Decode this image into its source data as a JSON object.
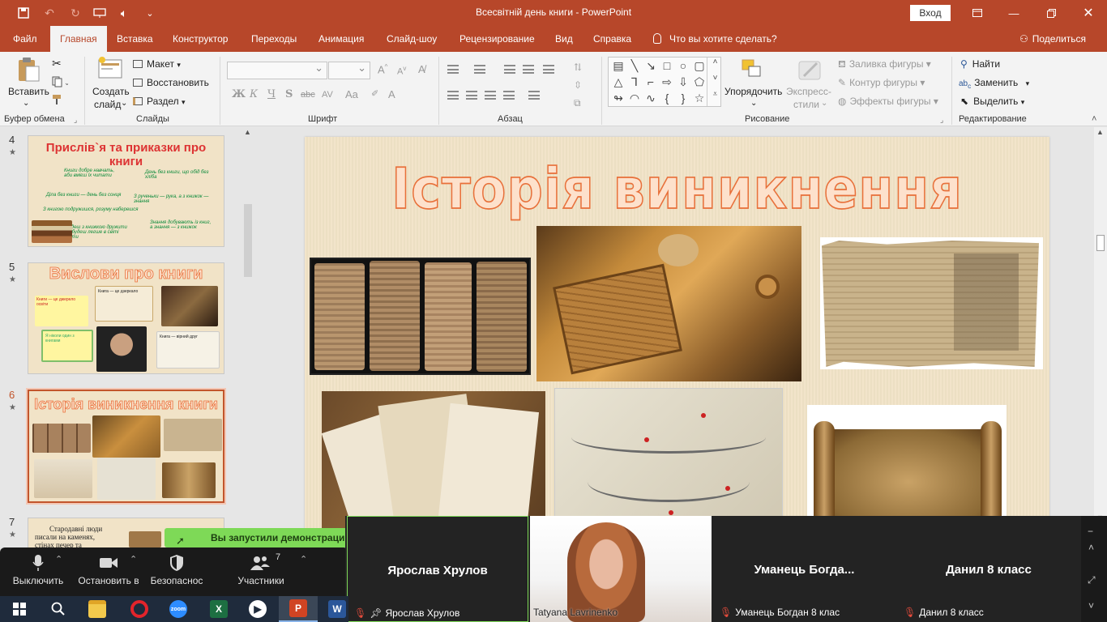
{
  "titlebar": {
    "document_title": "Всесвітній день книги  -  PowerPoint",
    "signin_label": "Вход",
    "icons": [
      "save-icon",
      "undo-icon",
      "redo-icon",
      "start-from-beginning-icon",
      "audio-icon",
      "customize-quick-access-icon",
      "ribbon-display-options-icon",
      "minimize-icon",
      "restore-icon",
      "close-icon"
    ]
  },
  "tabs": [
    "Файл",
    "Главная",
    "Вставка",
    "Конструктор",
    "Переходы",
    "Анимация",
    "Слайд-шоу",
    "Рецензирование",
    "Вид",
    "Справка"
  ],
  "active_tab": "Главная",
  "tell_me": "Что вы хотите сделать?",
  "share": "Поделиться",
  "ribbon": {
    "clipboard": {
      "paste": "Вставить",
      "group": "Буфер обмена"
    },
    "slides": {
      "new_slide_line1": "Создать",
      "new_slide_line2": "слайд",
      "layout": "Макет",
      "reset": "Восстановить",
      "section": "Раздел",
      "group": "Слайды"
    },
    "font": {
      "group": "Шрифт",
      "bold": "Ж",
      "italic": "К",
      "underline": "Ч",
      "shadow": "S",
      "strike": "abc",
      "spacing": "AV",
      "case": "Aa",
      "font_color": "A"
    },
    "paragraph": {
      "group": "Абзац"
    },
    "drawing": {
      "arrange": "Упорядочить",
      "quick_styles_line1": "Экспресс-",
      "quick_styles_line2": "стили",
      "fill": "Заливка фигуры",
      "outline": "Контур фигуры",
      "effects": "Эффекты фигуры",
      "group": "Рисование"
    },
    "editing": {
      "find": "Найти",
      "replace": "Заменить",
      "select": "Выделить",
      "group": "Редактирование"
    }
  },
  "slides_panel": [
    {
      "number": "4",
      "title": "Прислів`я та приказки про книги",
      "texts": [
        "Книги добре навчать, аби вмієш їх читати",
        "День без книги, що обід без хліба",
        "Діла без книги — день без сонця",
        "З рученьки — рука, а з книжок — знання",
        "З книгою подружишся, розуму наберешся",
        "Будеш з книжкою дружити — будеш легше в світі жити",
        "Знання добувають із книг, а знання — з книжок"
      ]
    },
    {
      "number": "5",
      "title": "Вислови про книги",
      "texts": [
        "Книги — це джерело освіти",
        "Книга — це дзеркало",
        "Я ніколи один з книгами",
        "Книга — вірний друг"
      ]
    },
    {
      "number": "6",
      "title": "Історія виникнення книги",
      "selected": true
    },
    {
      "number": "7",
      "texts": [
        "Стародавні люди",
        "писали на каменях,",
        "стінах печер та"
      ]
    }
  ],
  "slide": {
    "title": "Історія виникнення книги"
  },
  "notification": "Вы запустили демонстрацию",
  "zoom_controls": [
    {
      "label": "Выключить",
      "icon": "microphone-icon"
    },
    {
      "label": "Остановить в",
      "icon": "video-camera-icon"
    },
    {
      "label": "Безопаснос",
      "icon": "shield-icon"
    },
    {
      "label": "Участники",
      "icon": "participants-icon",
      "count": "7"
    }
  ],
  "video_tiles": [
    {
      "name": "Ярослав Хрулов",
      "label": "Ярослав Хрулов"
    },
    {
      "name": "",
      "label": "Tatyana Lavrinenko"
    },
    {
      "name": "Уманець  Богда...",
      "label": "Уманець Богдан 8 клас"
    },
    {
      "name": "Данил 8 класс",
      "label": "Данил 8 класс"
    }
  ],
  "taskbar": [
    "start-icon",
    "search-icon",
    "file-explorer-icon",
    "opera-icon",
    "zoom-icon",
    "excel-icon",
    "media-player-icon",
    "powerpoint-icon",
    "word-icon"
  ],
  "colors": {
    "accent": "#b7472a",
    "title_stroke": "#e8703a",
    "slide_bg": "#f1e3c7",
    "notice": "#7ed957"
  }
}
